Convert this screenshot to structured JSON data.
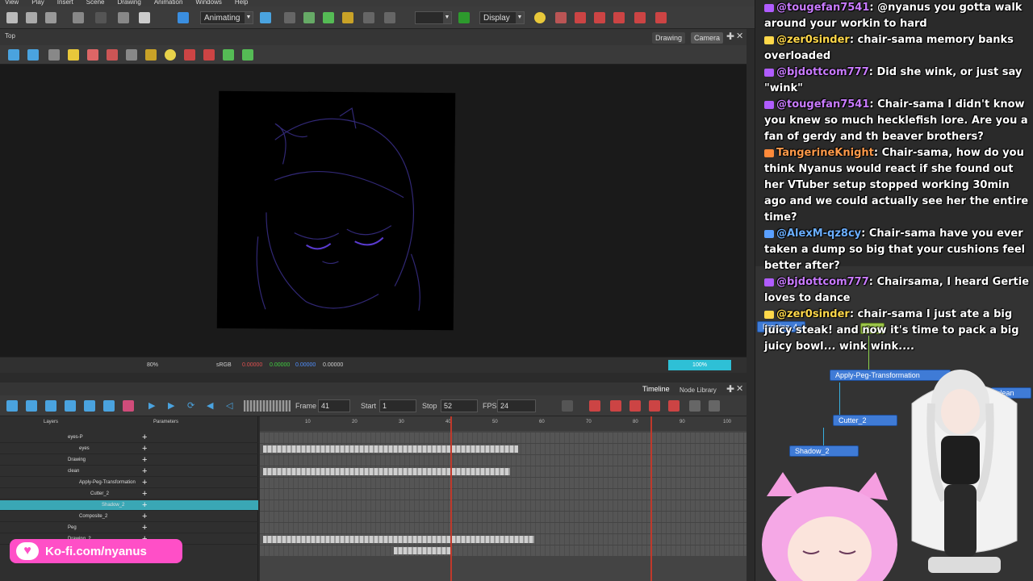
{
  "menu": [
    "View",
    "Play",
    "Insert",
    "Scene",
    "Drawing",
    "Animation",
    "Windows",
    "Help"
  ],
  "toolbar": {
    "mode": "Animating",
    "display": "Display"
  },
  "view": {
    "title": "Top",
    "tabs": [
      "Drawing",
      "Camera"
    ]
  },
  "status": {
    "zoom_text": "80%",
    "rgb": "sRGB",
    "values": [
      "0.00000",
      "0.00000",
      "0.00000",
      "0.00000"
    ],
    "zoom_bar": "100%"
  },
  "timeline": {
    "tabs": [
      "Timeline",
      "Node Library"
    ],
    "frame_label": "Frame",
    "frame": "41",
    "start_label": "Start",
    "start": "1",
    "stop_label": "Stop",
    "stop": "52",
    "fps_label": "FPS",
    "fps": "24",
    "col_layers": "Layers",
    "col_params": "Parameters",
    "layers": [
      "eyes-P",
      "eyes",
      "Drawing",
      "clean",
      "Apply-Peg-Transformation",
      "Cutter_2",
      "Shadow_2",
      "Composite_2",
      "Peg",
      "Drawing_2"
    ],
    "ruler": [
      "10",
      "20",
      "30",
      "40",
      "50",
      "60",
      "70",
      "80",
      "90",
      "100"
    ]
  },
  "kofi": {
    "text": "Ko-fi.com/nyanus"
  },
  "chat": [
    {
      "user": "@tougefan7541",
      "text": ": @nyanus you gotta walk around your workin to hard"
    },
    {
      "user": "@zer0sinder",
      "text": ": chair-sama memory banks overloaded"
    },
    {
      "user": "@bjdottcom777",
      "text": ": Did she wink, or just say \"wink\""
    },
    {
      "user": "@tougefan7541",
      "text": ": Chair-sama I didn't know you knew so much hecklefish lore. Are you a fan of gerdy and th beaver brothers?"
    },
    {
      "user": "TangerineKnight",
      "text": ": Chair-sama, how do you think Nyanus would react if she found out her VTuber setup stopped working 30min ago and we could actually see her the entire time?"
    },
    {
      "user": "@AlexM-qz8cy",
      "text": ": Chair-sama have you ever taken a dump so big that your cushions feel better after?"
    },
    {
      "user": "@bjdottcom777",
      "text": ": Chairsama, I heard Gertie loves to dance"
    },
    {
      "user": "@zer0sinder",
      "text": ": chair-sama I just ate a big juicy steak! and now it's time to pack a big juicy bowl... wink wink...."
    }
  ],
  "nodes": {
    "apply_peg": "Apply-Peg-Transformation",
    "cutter": "Cutter_2",
    "shadow": "Shadow_2",
    "peg": "Peg",
    "clean": "clean",
    "drawing": "Drawing_4"
  },
  "colors": {
    "accent": "#3aa7b5",
    "kofi": "#ff4fc7",
    "playhead": "#c0392b"
  }
}
